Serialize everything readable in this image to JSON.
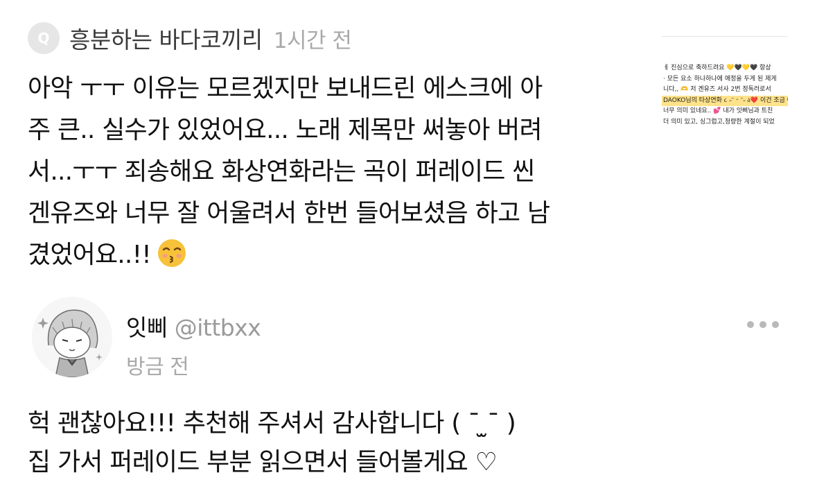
{
  "question": {
    "badge_letter": "Q",
    "asker_name": "흥분하는 바다코끼리",
    "time": "1시간 전",
    "lines": [
      "아악 ㅜㅜ 이유는 모르겠지만 보내드린 에스크에 아",
      "주 큰.. 실수가 있었어요... 노래 제목만 써놓아 버려",
      "서...ㅜㅜ 죄송해요 화상연화라는 곡이 퍼레이드 씬",
      "겐유즈와 너무 잘 어울려서 한번 들어보셨음 하고 남",
      "겼었어요..!!"
    ],
    "emoji": "kissing-face-with-closed-eyes"
  },
  "thumbnail": {
    "lines": [
      "ㅔ 진심으로 축하드려요 💛🖤💛🖤 항상",
      "· 모든 요소 하나하나에 애정을 두게 된 제게",
      "니다,, 🫶 저 겐유즈 서사 2번 정독러로서",
      "DAOKO님의 타상연화 ૮ ˶ᵔ ᵕ ᵔ˶ ა❤️ 이건 조금 여",
      "너무 의미 있네요.. 💕 내가 잇삐님과 트친",
      "더 의미 있고, 싱그럽고,청량한 계절이 되었"
    ]
  },
  "answer": {
    "nickname": "잇삐",
    "handle": "@ittbxx",
    "time": "방금 전",
    "lines": [
      "헉 괜찮아요!!! 추천해 주셔서 감사합니다 ( ˉ ̫ˉ )",
      "집 가서 퍼레이드 부분 읽으면서 들어볼게요 ♡"
    ]
  },
  "colors": {
    "text": "#111111",
    "secondary": "#a9a9a9",
    "badge_bg": "#e6e6e6",
    "dots": "#b9b9b9"
  },
  "icons": [
    "q-badge-icon",
    "more-options-icon",
    "avatar-drawing",
    "emoji-icon"
  ]
}
